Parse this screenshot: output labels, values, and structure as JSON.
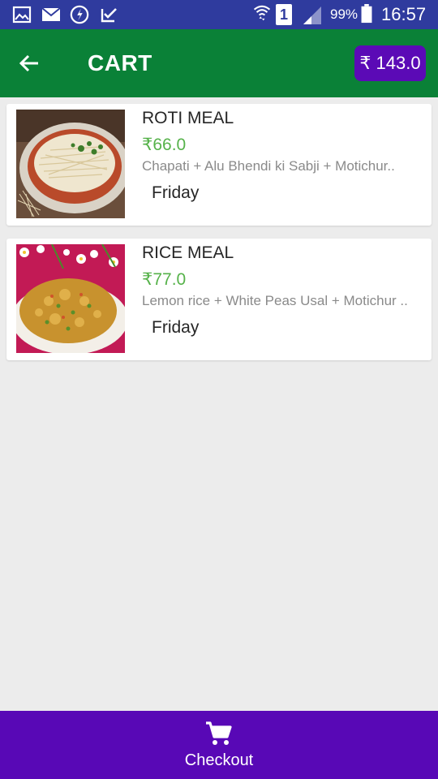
{
  "status_bar": {
    "battery_percent": "99%",
    "time": "16:57",
    "sim_slot": "1",
    "icons": [
      "gallery-icon",
      "mail-icon",
      "freecharge-icon",
      "task-icon",
      "wifi-icon",
      "sim-icon",
      "signal-icon",
      "battery-icon"
    ]
  },
  "app_bar": {
    "title": "CART",
    "total": "₹ 143.0",
    "back_icon": "arrow-left-icon",
    "background": "#0a8137",
    "badge_color": "#5b0ab6"
  },
  "cart_items": [
    {
      "name": "ROTI MEAL",
      "price": "₹66.0",
      "description": "Chapati + Alu Bhendi ki Sabji + Motichur..",
      "day": "Friday"
    },
    {
      "name": "RICE MEAL",
      "price": "₹77.0",
      "description": "Lemon rice + White Peas Usal + Motichur ..",
      "day": "Friday"
    }
  ],
  "checkout": {
    "label": "Checkout",
    "icon": "shopping-cart-icon",
    "background": "#5808b6"
  },
  "colors": {
    "price_green": "#56b24a",
    "status_bar": "#2f3b9e",
    "page_background": "#ececec"
  }
}
